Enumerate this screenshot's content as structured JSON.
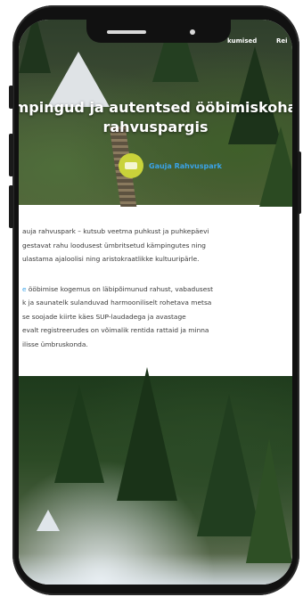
{
  "nav": {
    "items": [
      "kumised",
      "Rei"
    ]
  },
  "hero": {
    "title_line1": "mpingud ja autentsed ööbimiskoha",
    "title_line2": "rahvuspargis",
    "author_name": "Gauja Rahvuspark",
    "author_logo_color": "#c9d33a"
  },
  "article": {
    "paragraph1": [
      "auja rahvuspark – kutsub veetma puhkust ja puhkepäevi",
      "gestavat rahu loodusest ümbritsetud kämpingutes ning",
      "ulastama ajaloolisi ning aristokraatlikke kultuuripärle."
    ],
    "paragraph2_link": "e",
    "paragraph2": [
      " ööbimise kogemus on läbipõimunud rahust, vabadusest",
      "k ja saunatelk sulanduvad harmooniliselt rohetava metsa",
      "se soojade kiirte käes SUP-laudadega ja avastage",
      "evalt registreerudes on võimalik rentida rattaid ja minna",
      "ilisse ümbruskonda."
    ]
  },
  "colors": {
    "link": "#3aa3e8",
    "phone_frame": "#111111"
  }
}
